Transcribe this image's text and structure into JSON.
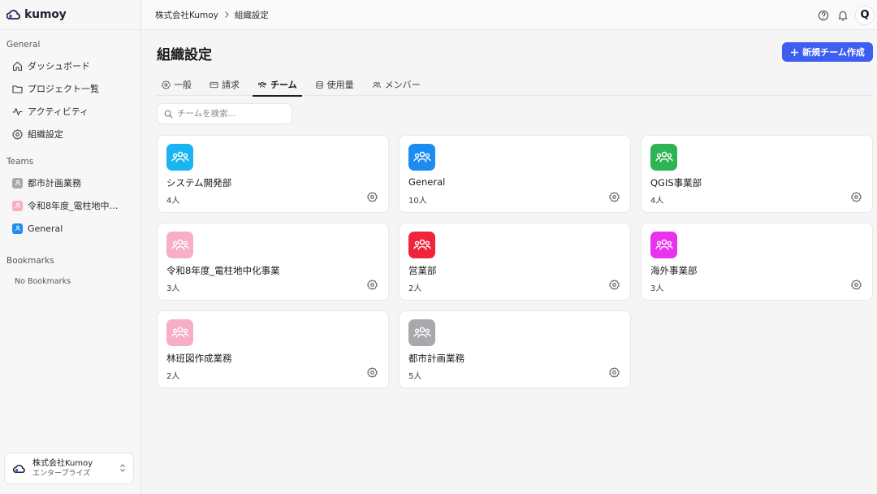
{
  "app": {
    "name": "kumoy"
  },
  "breadcrumb": [
    "株式会社Kumoy",
    "組織設定"
  ],
  "sidebar": {
    "general_label": "General",
    "nav": [
      {
        "label": "ダッシュボード",
        "icon": "home-icon"
      },
      {
        "label": "プロジェクト一覧",
        "icon": "folder-icon"
      },
      {
        "label": "アクティビティ",
        "icon": "activity-icon"
      },
      {
        "label": "組織設定",
        "icon": "gear-icon"
      }
    ],
    "teams_label": "Teams",
    "teams": [
      {
        "label": "都市計画業務",
        "color": "#a9a9ad"
      },
      {
        "label": "令和8年度_電柱地中化...",
        "color": "#f8aec4"
      },
      {
        "label": "General",
        "color": "#1d8cf0"
      }
    ],
    "bookmarks_label": "Bookmarks",
    "no_bookmarks": "No Bookmarks",
    "org": {
      "name": "株式会社Kumoy",
      "plan": "エンタープライズ"
    }
  },
  "header": {
    "avatar_initial": "Q"
  },
  "main": {
    "title": "組織設定",
    "new_team_button": "新規チーム作成",
    "tabs": [
      {
        "label": "一般",
        "icon": "gear-icon"
      },
      {
        "label": "請求",
        "icon": "credit-card-icon"
      },
      {
        "label": "チーム",
        "icon": "users-icon",
        "active": true
      },
      {
        "label": "使用量",
        "icon": "database-icon"
      },
      {
        "label": "メンバー",
        "icon": "members-icon"
      }
    ],
    "search_placeholder": "チームを検索...",
    "teams": [
      {
        "name": "システム開発部",
        "count": "4人",
        "color": "#1ab4f0"
      },
      {
        "name": "General",
        "count": "10人",
        "color": "#1d8cf0"
      },
      {
        "name": "QGIS事業部",
        "count": "4人",
        "color": "#2fb455"
      },
      {
        "name": "令和8年度_電柱地中化事業",
        "count": "3人",
        "color": "#f8aec4"
      },
      {
        "name": "営業部",
        "count": "2人",
        "color": "#f0243c"
      },
      {
        "name": "海外事業部",
        "count": "3人",
        "color": "#e832ee"
      },
      {
        "name": "林班図作成業務",
        "count": "2人",
        "color": "#f8aec4"
      },
      {
        "name": "都市計画業務",
        "count": "5人",
        "color": "#a9a9ad"
      }
    ]
  }
}
